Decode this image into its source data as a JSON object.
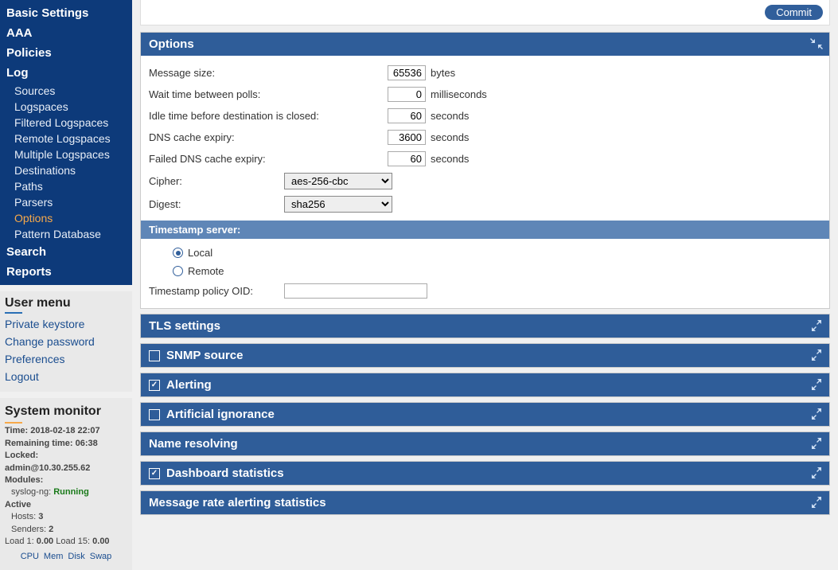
{
  "nav": {
    "main": [
      {
        "label": "Basic Settings",
        "sub": []
      },
      {
        "label": "AAA",
        "sub": []
      },
      {
        "label": "Policies",
        "sub": []
      },
      {
        "label": "Log",
        "sub": [
          "Sources",
          "Logspaces",
          "Filtered Logspaces",
          "Remote Logspaces",
          "Multiple Logspaces",
          "Destinations",
          "Paths",
          "Parsers",
          "Options",
          "Pattern Database"
        ],
        "active": "Options"
      },
      {
        "label": "Search",
        "sub": []
      },
      {
        "label": "Reports",
        "sub": []
      }
    ]
  },
  "usermenu": {
    "title": "User menu",
    "items": [
      "Private keystore",
      "Change password",
      "Preferences",
      "Logout"
    ]
  },
  "sysmon": {
    "title": "System monitor",
    "time_label": "Time:",
    "time": "2018-02-18 22:07",
    "remaining_label": "Remaining time:",
    "remaining": "06:38",
    "locked_label": "Locked:",
    "locked": "admin@10.30.255.62",
    "modules_label": "Modules:",
    "module": "syslog-ng:",
    "module_state": "Running",
    "active_label": "Active",
    "hosts_label": "Hosts:",
    "hosts": "3",
    "senders_label": "Senders:",
    "senders": "2",
    "load1_label": "Load 1:",
    "load1": "0.00",
    "load15_label": "Load 15:",
    "load15": "0.00",
    "foot": [
      "CPU",
      "Mem",
      "Disk",
      "Swap"
    ]
  },
  "commit": {
    "label": "Commit"
  },
  "options": {
    "title": "Options",
    "rows": {
      "msg": {
        "label": "Message size:",
        "value": "65536",
        "unit": "bytes"
      },
      "wait": {
        "label": "Wait time between polls:",
        "value": "0",
        "unit": "milliseconds"
      },
      "idle": {
        "label": "Idle time before destination is closed:",
        "value": "60",
        "unit": "seconds"
      },
      "dns": {
        "label": "DNS cache expiry:",
        "value": "3600",
        "unit": "seconds"
      },
      "fdns": {
        "label": "Failed DNS cache expiry:",
        "value": "60",
        "unit": "seconds"
      },
      "cipher": {
        "label": "Cipher:",
        "value": "aes-256-cbc"
      },
      "digest": {
        "label": "Digest:",
        "value": "sha256"
      }
    },
    "ts": {
      "title": "Timestamp server:",
      "local": "Local",
      "remote": "Remote",
      "oid_label": "Timestamp policy OID:",
      "oid": ""
    }
  },
  "sections": {
    "tls": "TLS settings",
    "snmp": "SNMP source",
    "alerting": "Alerting",
    "ai": "Artificial ignorance",
    "name": "Name resolving",
    "dash": "Dashboard statistics",
    "mras": "Message rate alerting statistics"
  }
}
